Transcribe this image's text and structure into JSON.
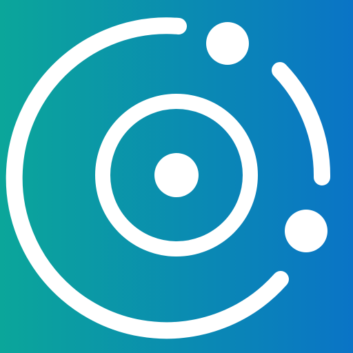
{
  "icon": {
    "name": "orbit-logo-icon",
    "colors": {
      "gradient_start": "#0BA69A",
      "gradient_end": "#0A74C6",
      "foreground": "#FFFFFF"
    }
  }
}
